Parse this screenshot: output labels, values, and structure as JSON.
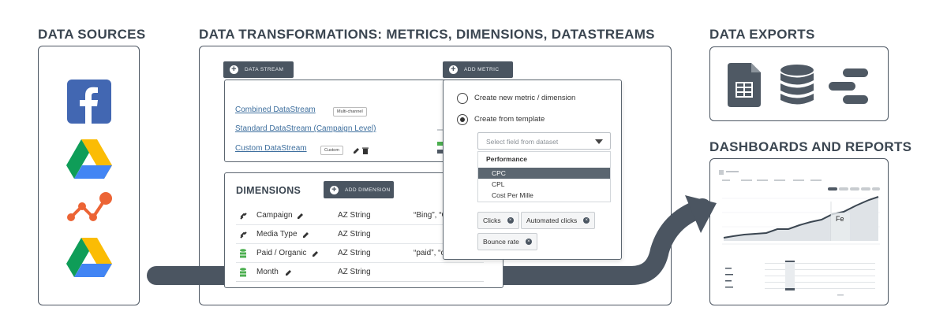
{
  "sections": {
    "sources_title": "DATA SOURCES",
    "transform_title": "DATA TRANSFORMATIONS: METRICS, DIMENSIONS, DATASTREAMS",
    "exports_title": "DATA EXPORTS",
    "dashboards_title": "DASHBOARDS AND REPORTS"
  },
  "datastream": {
    "button_label": "DATA STREAM",
    "links": [
      "Combined DataStream",
      "Standard DataStream (Campaign Level)",
      "Custom DataStream"
    ],
    "chips": [
      "Multi-channel",
      "Custom"
    ]
  },
  "metric": {
    "button_label": "ADD METRIC",
    "radio_new": "Create new metric / dimension",
    "radio_template": "Create from template",
    "select_placeholder": "Select field from dataset",
    "dropdown_header": "Performance",
    "dropdown_items": [
      "CPC",
      "CPL",
      "Cost Per Mille"
    ],
    "tags": [
      "Clicks",
      "Automated clicks",
      "Bounce rate"
    ]
  },
  "dimensions": {
    "title": "DIMENSIONS",
    "button_label": "ADD DIMENSION",
    "rows": [
      {
        "name": "Campaign",
        "type": "AZ String",
        "example": "“Bing”, “G"
      },
      {
        "name": "Media Type",
        "type": "AZ String",
        "example": ""
      },
      {
        "name": "Paid / Organic",
        "type": "AZ String",
        "example": "“paid”, “o"
      },
      {
        "name": "Month",
        "type": "AZ String",
        "example": ""
      }
    ]
  },
  "dashboard": {
    "tooltip": "Fe"
  },
  "colors": {
    "panel_border": "#4b5561",
    "button_dark": "#4a5561",
    "facebook_blue": "#4267b2",
    "arrow": "#4b5561"
  }
}
